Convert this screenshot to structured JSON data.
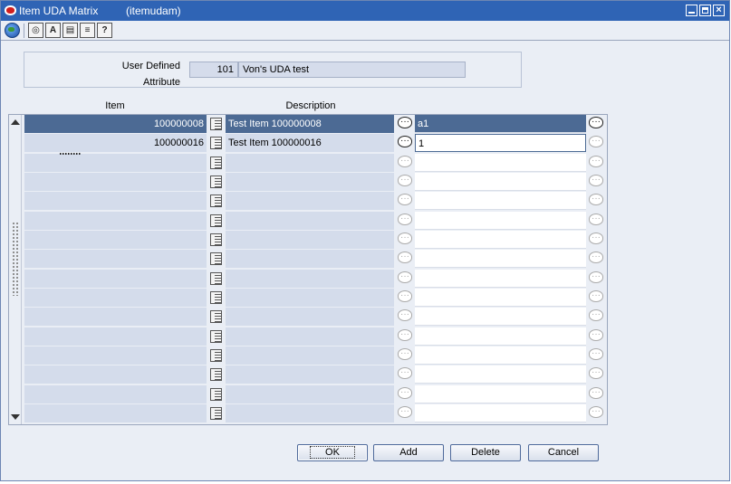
{
  "window": {
    "title": "Item UDA Matrix",
    "module": "(itemudam)"
  },
  "uda": {
    "label_line1": "User Defined",
    "label_line2": "Attribute",
    "code": "101",
    "description": "Von's UDA test"
  },
  "grid": {
    "headers": {
      "item": "Item",
      "description": "Description"
    },
    "rows": [
      {
        "item": "100000008",
        "description": "Test Item 100000008",
        "value": "a1"
      },
      {
        "item": "100000016",
        "description": "Test Item 100000016",
        "value": "1"
      },
      {
        "item": "",
        "description": "",
        "value": ""
      },
      {
        "item": "",
        "description": "",
        "value": ""
      },
      {
        "item": "",
        "description": "",
        "value": ""
      },
      {
        "item": "",
        "description": "",
        "value": ""
      },
      {
        "item": "",
        "description": "",
        "value": ""
      },
      {
        "item": "",
        "description": "",
        "value": ""
      },
      {
        "item": "",
        "description": "",
        "value": ""
      },
      {
        "item": "",
        "description": "",
        "value": ""
      },
      {
        "item": "",
        "description": "",
        "value": ""
      },
      {
        "item": "",
        "description": "",
        "value": ""
      },
      {
        "item": "",
        "description": "",
        "value": ""
      },
      {
        "item": "",
        "description": "",
        "value": ""
      },
      {
        "item": "",
        "description": "",
        "value": ""
      },
      {
        "item": "",
        "description": "",
        "value": ""
      }
    ]
  },
  "buttons": {
    "ok": "OK",
    "add": "Add",
    "delete": "Delete",
    "cancel": "Cancel"
  },
  "toolbar": {
    "icons": [
      "globe-icon",
      "clipboard-icon",
      "find-icon",
      "note-icon",
      "list-icon",
      "help-icon"
    ]
  },
  "colors": {
    "titlebar": "#2f64b5",
    "selected_row": "#4c6a94",
    "readonly_cell": "#d4dceb",
    "window_bg": "#eaeef5"
  }
}
